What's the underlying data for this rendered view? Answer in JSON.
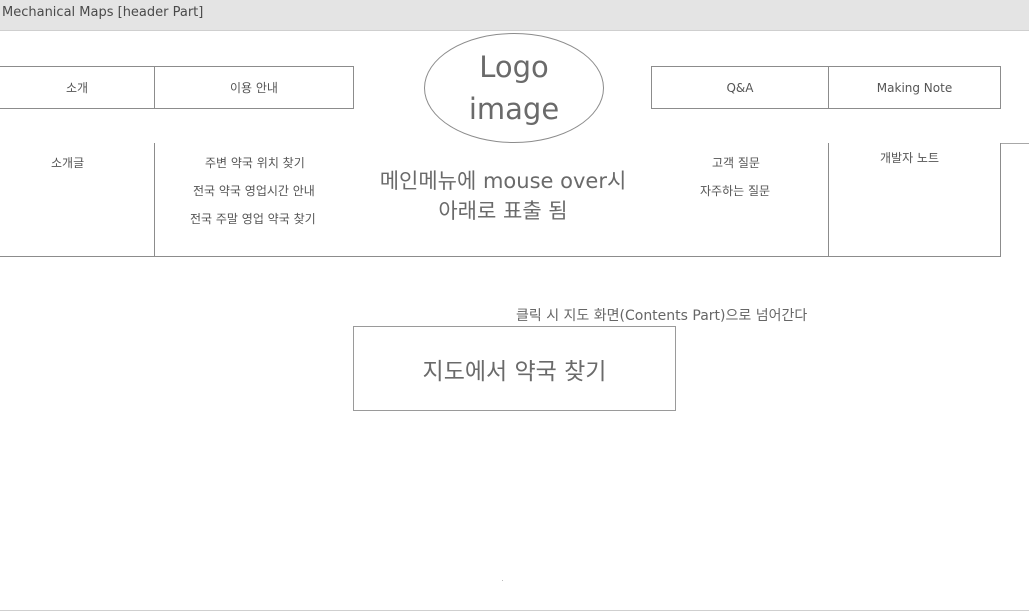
{
  "window": {
    "title": "Mechanical Maps [header Part]"
  },
  "header": {
    "nav_left": [
      {
        "label": "소개"
      },
      {
        "label": "이용 안내"
      }
    ],
    "logo": {
      "line1": "Logo",
      "line2": "image"
    },
    "nav_right": [
      {
        "label": "Q&A"
      },
      {
        "label": "Making Note"
      }
    ]
  },
  "dropdown": {
    "col1": [
      "소개글"
    ],
    "col2": [
      "주변 약국 위치 찾기",
      "전국 약국 영업시간 안내",
      "전국 주말 영업 약국 찾기"
    ],
    "note": {
      "line1": "메인메뉴에 mouse over시",
      "line2": "아래로 표출 됨"
    },
    "col4": [
      "고객 질문",
      "자주하는 질문"
    ],
    "col5": [
      "개발자 노트"
    ]
  },
  "content": {
    "click_note": "클릭 시 지도 화면(Contents Part)으로 넘어간다",
    "map_button_label": "지도에서 약국 찾기"
  }
}
